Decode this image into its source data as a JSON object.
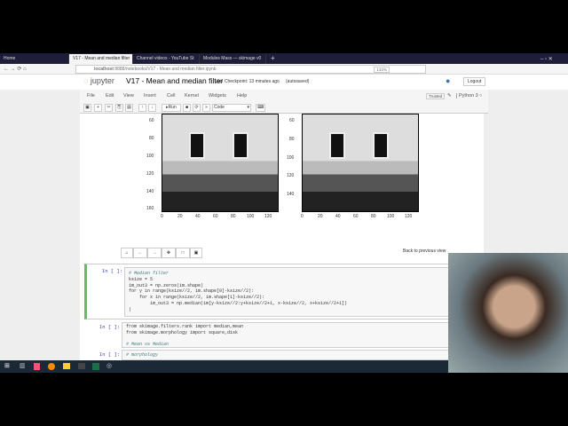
{
  "browser": {
    "tabs": [
      {
        "label": "Home"
      },
      {
        "label": "V17 - Mean and median filter"
      },
      {
        "label": "Channel videos - YouTube St"
      },
      {
        "label": "Modules Mass — skimage v0"
      }
    ],
    "url_host": "localhost",
    "url_rest": ":8888/notebooks/V17 - Mean and median filter.ipynb",
    "zoom": "133%"
  },
  "jupyter": {
    "logo": "jupyter",
    "title": "V17 - Mean and median filter",
    "checkpoint": "Last Checkpoint: 13 minutes ago",
    "autosave": "(autosaved)",
    "logout": "Logout",
    "menu": [
      "File",
      "Edit",
      "View",
      "Insert",
      "Cell",
      "Kernel",
      "Widgets",
      "Help"
    ],
    "trusted": "Trusted",
    "kernel": "Python 3",
    "run": "Run",
    "cell_type": "Code"
  },
  "plot": {
    "left_yticks": [
      "60",
      "80",
      "100",
      "120",
      "140",
      "160"
    ],
    "right_yticks": [
      "60",
      "80",
      "100",
      "120",
      "140"
    ],
    "xticks": [
      "0",
      "20",
      "40",
      "60",
      "80",
      "100",
      "120"
    ],
    "back": "Back to previous view"
  },
  "cells": [
    {
      "prompt": "In [ ]:",
      "lines": [
        "# Median filter",
        "ksize = 5",
        "im_out3 = np.zeros(im.shape)",
        "for y in range(ksize//2, im.shape[0]-ksize//2):",
        "    for x in range(ksize//2, im.shape[1]-ksize//2):",
        "        im_out3 = np.median(im[y-ksize//2:y+ksize//2+1, x-ksize//2, x+ksize//2+1])"
      ]
    },
    {
      "prompt": "In [ ]:",
      "lines": [
        "from skimage.filters.rank import median,mean",
        "from skimage.morphology import square,disk",
        "",
        "# Mean vs Median"
      ]
    },
    {
      "prompt": "In [ ]:",
      "lines": [
        "# morphology"
      ]
    }
  ]
}
